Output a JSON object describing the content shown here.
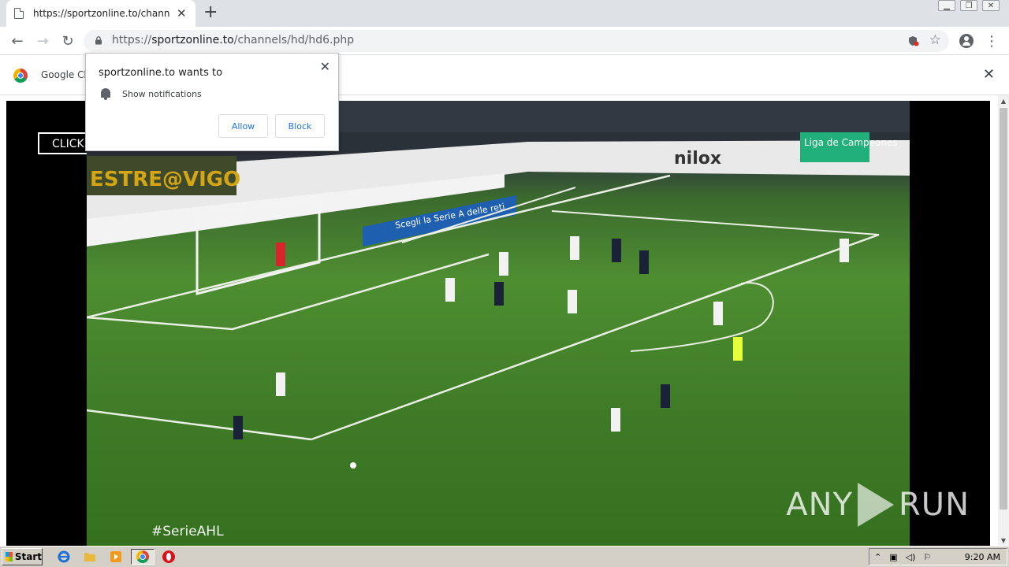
{
  "tab": {
    "title": "https://sportzonline.to/channels/hd/",
    "close": "✕"
  },
  "window": {
    "minimize": "▁",
    "restore": "❐",
    "close": "✕"
  },
  "toolbar": {
    "back": "←",
    "forward": "→",
    "reload": "↻",
    "url_scheme": "https://",
    "url_host": "sportzonline.to",
    "url_path": "/channels/hd/hd6.php",
    "star": "☆",
    "menu": "⋮"
  },
  "infobar": {
    "message": "Google Ch",
    "close": "✕"
  },
  "popup": {
    "heading": "sportzonline.to wants to",
    "permission": "Show notifications",
    "allow": "Allow",
    "block": "Block",
    "close": "✕"
  },
  "player": {
    "click_text": "CLICK",
    "hashtag": "#SerieAHL",
    "board_1": "ESTRE@VIGO",
    "board_2": "nilox",
    "board_3": "Scegli la Serie A delle reti",
    "board_4": "Liga de Campeones"
  },
  "watermark": {
    "left": "ANY",
    "right": "RUN"
  },
  "taskbar": {
    "start": "Start",
    "clock": "9:20 AM"
  }
}
